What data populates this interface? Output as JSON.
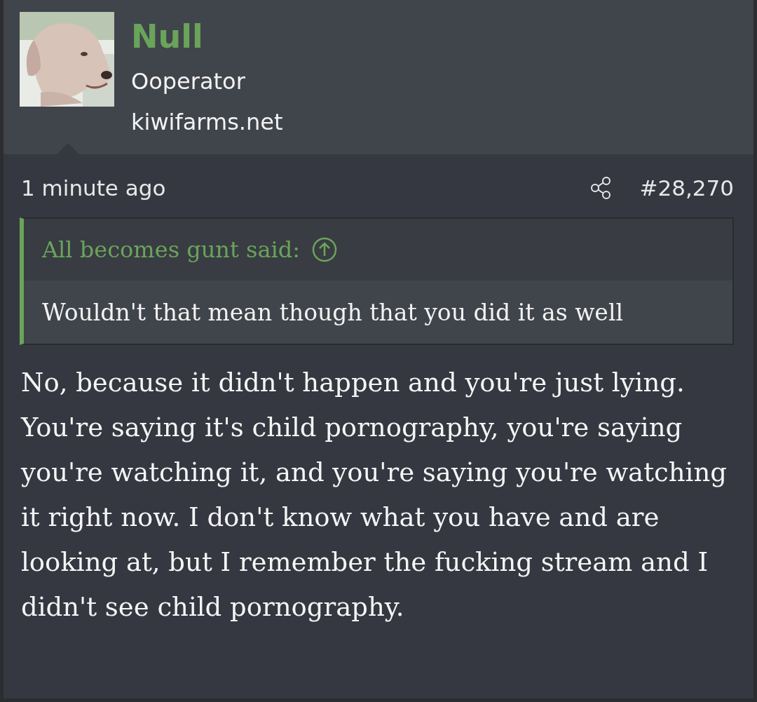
{
  "author": {
    "name": "Null",
    "title": "Ooperator",
    "site": "kiwifarms.net"
  },
  "post": {
    "time": "1 minute ago",
    "number": "#28,270"
  },
  "quote": {
    "attribution": "All becomes gunt said:",
    "text": "Wouldn't that mean though that you did it as well"
  },
  "body": "No, because it didn't happen and you're just lying. You're saying it's child pornography, you're saying you're watching it, and you're saying you're watching it right now. I don't know what you have and are looking at, but I remember the fucking stream and I didn't see child pornography."
}
